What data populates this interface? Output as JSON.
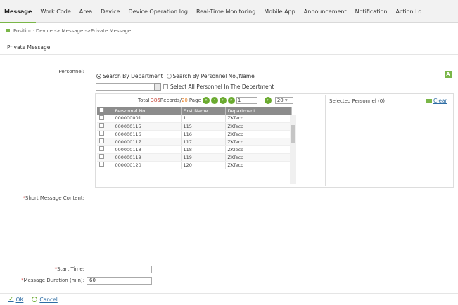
{
  "nav": [
    "Message",
    "Work Code",
    "Area",
    "Device",
    "Device Operation log",
    "Real-Time Monitoring",
    "Mobile App",
    "Announcement",
    "Notification",
    "Action Lo"
  ],
  "breadcrumb": "Position: Device -> Message ->Private Message",
  "page_title": "Private Message",
  "personnel": {
    "label": "Personnel:",
    "radio_department": "Search By Department",
    "radio_personnel": "Search By Personnel No./Name",
    "select_all_label": "Select All Personnel In The Department",
    "green_badge": "A"
  },
  "pager": {
    "total_prefix": "Total",
    "total": "386",
    "records_label": "Records/",
    "pages": "20",
    "page_label": "Page",
    "current_page": "1",
    "page_size": "20"
  },
  "grid": {
    "columns": [
      "Personnel No.",
      "First Name",
      "Department"
    ],
    "rows": [
      {
        "no": "000000001",
        "name": "1",
        "dept": "ZKTeco"
      },
      {
        "no": "000000115",
        "name": "115",
        "dept": "ZKTeco"
      },
      {
        "no": "000000116",
        "name": "116",
        "dept": "ZKTeco"
      },
      {
        "no": "000000117",
        "name": "117",
        "dept": "ZKTeco"
      },
      {
        "no": "000000118",
        "name": "118",
        "dept": "ZKTeco"
      },
      {
        "no": "000000119",
        "name": "119",
        "dept": "ZKTeco"
      },
      {
        "no": "000000120",
        "name": "120",
        "dept": "ZKTeco"
      }
    ]
  },
  "selected": {
    "title": "Selected Personnel (0)",
    "clear": "Clear"
  },
  "form": {
    "short_msg_label": "Short Message Content:",
    "start_time_label": "Start Time:",
    "duration_label": "Message Duration (min):",
    "duration_value": "60",
    "required_mark": "*"
  },
  "footer": {
    "ok": "OK",
    "cancel": "Cancel"
  }
}
